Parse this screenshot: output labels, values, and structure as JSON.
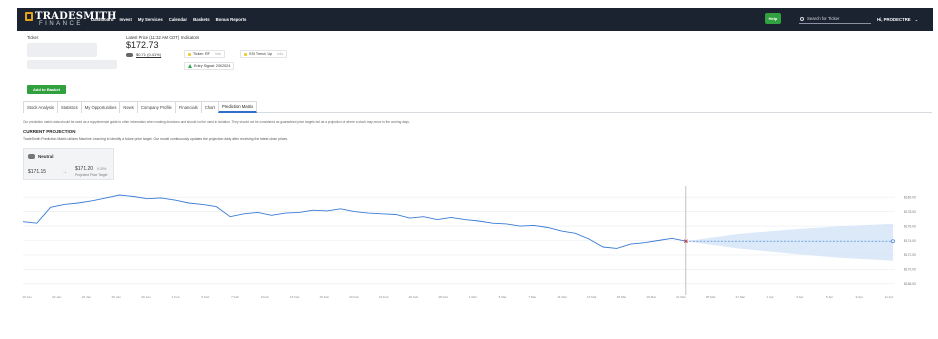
{
  "nav": {
    "logo_main": "TRADESMITH",
    "logo_sub": "FINANCE",
    "menu": [
      "Dashboard",
      "Invest",
      "My Services",
      "Calendar",
      "Baskets",
      "Bonus Reports"
    ],
    "help_label": "Help",
    "search_placeholder": "Search for Ticker",
    "user_label": "Hi, PRODECTRE",
    "accent_color": "#31a13f",
    "bar_color": "#1b2230"
  },
  "header": {
    "ticker_label": "Ticker",
    "latest_price_label": "Latest Price (11:32 AM CDT)",
    "latest_price": "$172.73",
    "change": "$0.71 (0.41%)",
    "indicators_label": "Indicators",
    "indicators": [
      {
        "text": "Ticker: RF",
        "note": "Info",
        "icon": "yellow-dot"
      },
      {
        "text": "SSI Trend: Up",
        "note": "Info",
        "icon": "yellow-dot"
      },
      {
        "text": "Entry Signal: 2/5/2024",
        "note": "",
        "icon": "green-triangle"
      }
    ],
    "add_basket_label": "Add to Basket"
  },
  "tabs": [
    {
      "label": "Stock Analysis",
      "active": false
    },
    {
      "label": "Statistics",
      "active": false
    },
    {
      "label": "My Opportunities",
      "active": false
    },
    {
      "label": "News",
      "active": false
    },
    {
      "label": "Company Profile",
      "active": false
    },
    {
      "label": "Financials",
      "active": false
    },
    {
      "label": "Chart",
      "active": false
    },
    {
      "label": "Prediction Matrix",
      "active": true
    }
  ],
  "disclaimer": "Our prediction matrix data should be used as a supplemental guide to other information when making decisions and should not be used in isolation. They should not be considered as guaranteed price targets but as a projection of where a stock may move in the coming days.",
  "projection": {
    "title": "CURRENT PROJECTION",
    "subtitle": "TradeSmith Prediction Matrix utilizes Machine Learning to identify a future price target. Our model continuously updates the projection daily after receiving the latest close prices.",
    "sentiment": "Neutral",
    "current_price": "$171.15",
    "projected_price": "$171.20",
    "projected_change": "0.03%",
    "projected_label": "Projected Price Target"
  },
  "chart_data": {
    "type": "line",
    "x_labels": [
      "19 Jan",
      "22 Jan",
      "24 Jan",
      "26 Jan",
      "30 Jan",
      "1 Feb",
      "5 Feb",
      "7 Feb",
      "9 Feb",
      "13 Feb",
      "15 Feb",
      "20 Feb",
      "22 Feb",
      "26 Feb",
      "28 Feb",
      "1 Mar",
      "5 Mar",
      "7 Mar",
      "11 Mar",
      "13 Mar",
      "15 Mar",
      "19 Mar",
      "21 Mar",
      "25 Mar",
      "27 Mar",
      "1 Apr",
      "3 Apr",
      "5 Apr",
      "9 Apr",
      "11 Apr"
    ],
    "y_ticks": [
      168,
      170,
      172,
      174,
      176,
      178,
      180
    ],
    "ylim": [
      167,
      181
    ],
    "series": [
      {
        "values": [
          176.6,
          176.4,
          178.6,
          179.0,
          179.2,
          179.5,
          179.9,
          180.3,
          180.1,
          179.8,
          179.9,
          179.6,
          179.2,
          179.0,
          178.7,
          177.3,
          177.7,
          177.9,
          177.5,
          177.8,
          177.9,
          178.2,
          178.1,
          178.4,
          178.0,
          177.8,
          177.7,
          177.6,
          177.1,
          177.3,
          176.9,
          177.2,
          176.9,
          176.7,
          176.4,
          176.3,
          176.0,
          176.1,
          175.8,
          175.3,
          175.0,
          174.2,
          173.1,
          172.9,
          173.5,
          173.7,
          174.0,
          174.3,
          173.9
        ]
      },
      {
        "values": [
          173.9,
          173.9,
          173.9,
          173.9,
          173.9,
          173.9,
          173.9,
          173.9,
          173.9,
          173.9,
          173.9,
          173.9,
          173.9,
          173.9,
          173.9,
          173.9
        ]
      }
    ],
    "band": {
      "upper": [
        173.9,
        174.9,
        175.5,
        176.0,
        176.3
      ],
      "lower": [
        173.9,
        172.9,
        172.2,
        171.6,
        171.2
      ]
    },
    "divider_index": 48,
    "colors": {
      "line": "#3a7bd5",
      "band": "#d6e5f7",
      "marker": "#d23030",
      "grid": "#e9ecef"
    }
  }
}
